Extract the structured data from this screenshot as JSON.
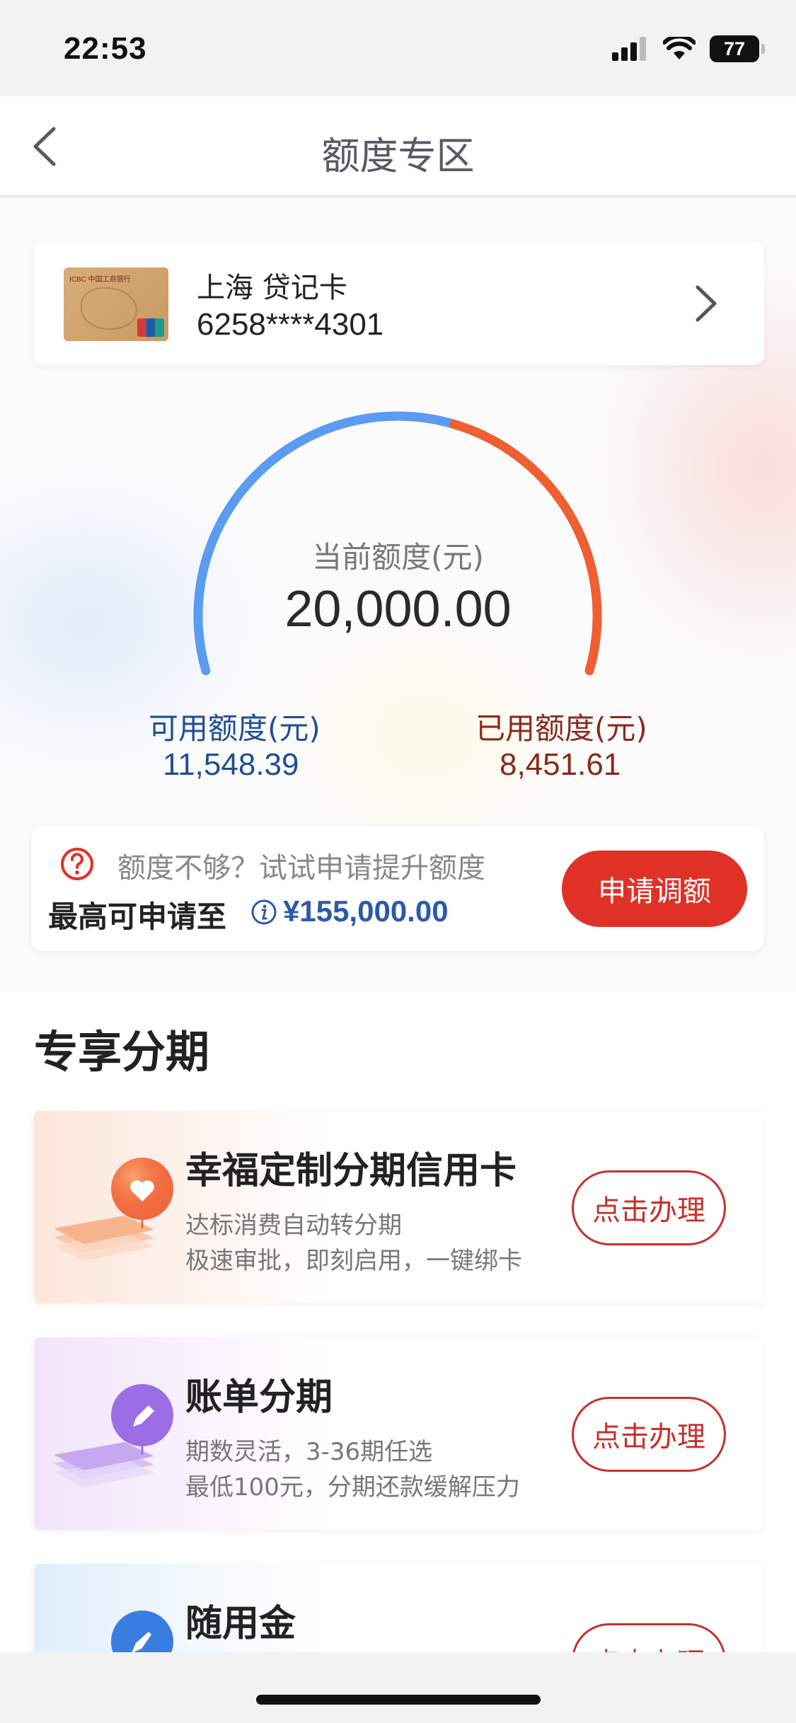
{
  "status_bar": {
    "time": "22:53",
    "battery": "77"
  },
  "nav": {
    "title": "额度专区"
  },
  "card": {
    "name": "上海 贷记卡",
    "number": "6258****4301",
    "brand_text": "ICBC 中国工商银行"
  },
  "gauge": {
    "current_label": "当前额度(元)",
    "current_value": "20,000.00",
    "available_label": "可用额度(元)",
    "available_value": "11,548.39",
    "used_label": "已用额度(元)",
    "used_value": "8,451.61",
    "available_fraction": 0.5774,
    "colors": {
      "available": "#5b9bf0",
      "used": "#ef5f32"
    }
  },
  "increase": {
    "hint": "额度不够？试试申请提升额度",
    "max_label": "最高可申请至",
    "max_value": "¥155,000.00",
    "apply_label": "申请调额"
  },
  "section": {
    "title": "专享分期",
    "offers": [
      {
        "title": "幸福定制分期信用卡",
        "desc1": "达标消费自动转分期",
        "desc2": "极速审批，即刻启用，一键绑卡",
        "button": "点击办理",
        "icon": "heart-icon"
      },
      {
        "title": "账单分期",
        "desc1": "期数灵活，3-36期任选",
        "desc2": "最低100元，分期还款缓解压力",
        "button": "点击办理",
        "icon": "pencil-icon"
      },
      {
        "title": "随用金",
        "desc1": "",
        "desc2": "",
        "button": "点击办理",
        "icon": "rocket-icon"
      }
    ]
  },
  "colors": {
    "accent_red": "#e03127",
    "link_blue": "#2c5aa8"
  }
}
